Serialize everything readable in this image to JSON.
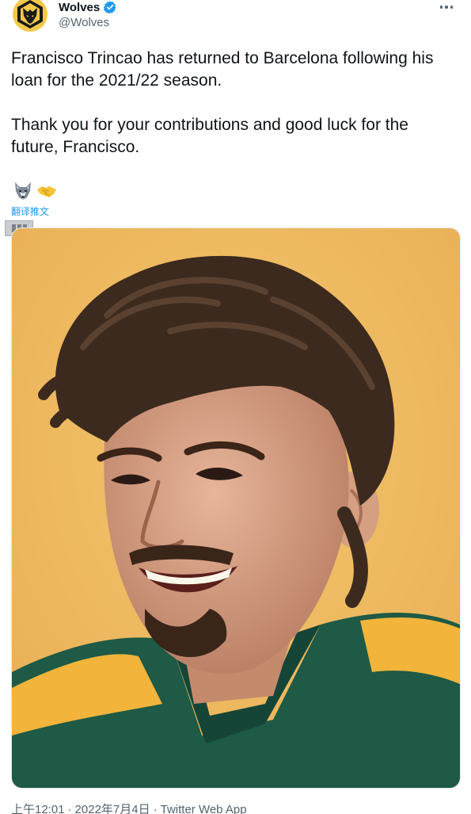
{
  "author": {
    "name": "Wolves",
    "handle": "@Wolves",
    "verified": true,
    "avatar_icon": "wolves-logo-icon"
  },
  "tweet": {
    "paragraph1": "Francisco Trincao has returned to Barcelona following his loan for the 2021/22 season.",
    "paragraph2": "Thank you for your contributions and good luck for the future, Francisco.",
    "emojis": [
      "wolf-emoji-icon",
      "handshake-emoji-icon"
    ],
    "translate_label": "翻译推文"
  },
  "media": {
    "kind": "photo",
    "background_color": "#efba5f"
  },
  "meta": {
    "time": "上午12:01",
    "date": "2022年7月4日",
    "source": "Twitter Web App"
  },
  "colors": {
    "link": "#1d9bf0",
    "text": "#0f1419",
    "secondary": "#536471",
    "brand_gold": "#f2c84b"
  }
}
